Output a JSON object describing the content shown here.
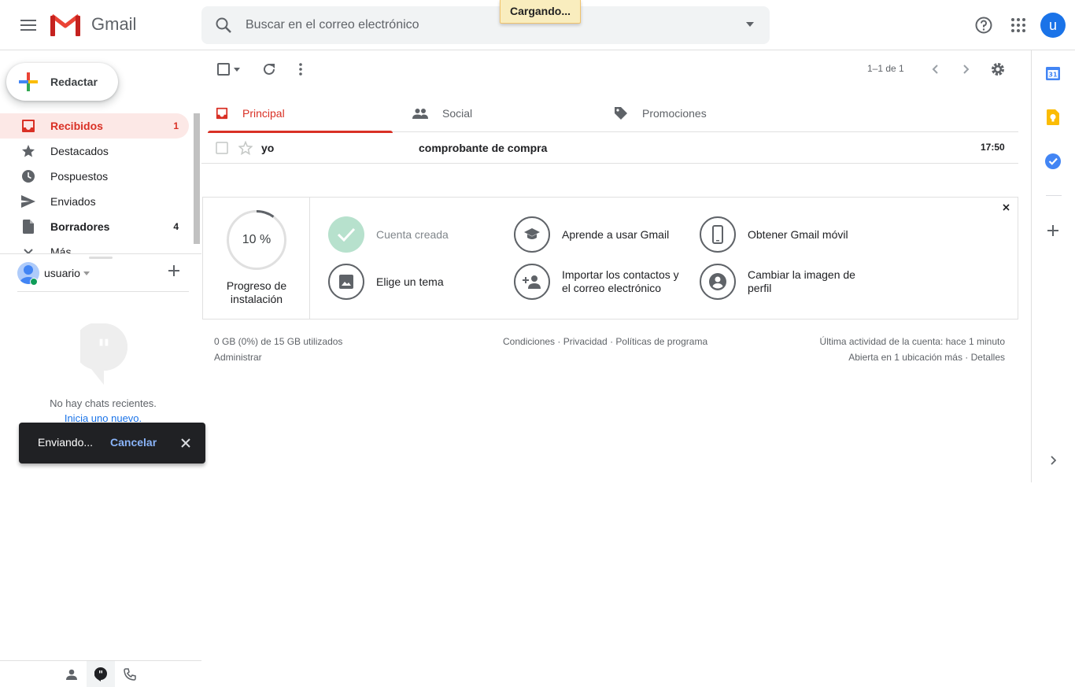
{
  "app": {
    "name": "Gmail",
    "loading": "Cargando..."
  },
  "search": {
    "placeholder": "Buscar en el correo electrónico"
  },
  "account": {
    "initial": "u"
  },
  "compose": {
    "label": "Redactar"
  },
  "sidebar": {
    "items": [
      {
        "label": "Recibidos",
        "count": "1",
        "icon": "inbox-icon"
      },
      {
        "label": "Destacados",
        "count": "",
        "icon": "star-icon"
      },
      {
        "label": "Pospuestos",
        "count": "",
        "icon": "clock-icon"
      },
      {
        "label": "Enviados",
        "count": "",
        "icon": "send-icon"
      },
      {
        "label": "Borradores",
        "count": "4",
        "icon": "draft-icon"
      },
      {
        "label": "Más",
        "count": "",
        "icon": "chevron-down-icon"
      }
    ]
  },
  "hangouts": {
    "user": "usuario",
    "empty": "No hay chats recientes.",
    "start_new": "Inicia uno nuevo."
  },
  "toolbar": {
    "pager": "1–1 de 1"
  },
  "tabs": [
    {
      "label": "Principal",
      "icon": "inbox-icon"
    },
    {
      "label": "Social",
      "icon": "people-icon"
    },
    {
      "label": "Promociones",
      "icon": "tag-icon"
    }
  ],
  "messages": [
    {
      "sender": "yo",
      "subject": "comprobante de compra",
      "time": "17:50"
    }
  ],
  "setup": {
    "progress": "10 %",
    "progress_fraction": 0.1,
    "progress_label": "Progreso de instalación",
    "items": [
      {
        "label": "Cuenta creada",
        "done": true
      },
      {
        "label": "Aprende a usar Gmail"
      },
      {
        "label": "Obtener Gmail móvil"
      },
      {
        "label": "Elige un tema"
      },
      {
        "label": "Importar los contactos y el correo electrónico"
      },
      {
        "label": "Cambiar la imagen de perfil"
      }
    ]
  },
  "footer": {
    "storage": "0 GB (0%) de 15 GB utilizados",
    "manage": "Administrar",
    "links": "Condiciones · Privacidad · Políticas de programa",
    "activity": "Última actividad de la cuenta: hace 1 minuto",
    "details": "Abierta en 1 ubicación más · Detalles"
  },
  "snackbar": {
    "text": "Enviando...",
    "action": "Cancelar"
  },
  "colors": {
    "accent_red": "#d93025",
    "blue": "#1a73e8",
    "active_bg": "#fce8e6"
  }
}
